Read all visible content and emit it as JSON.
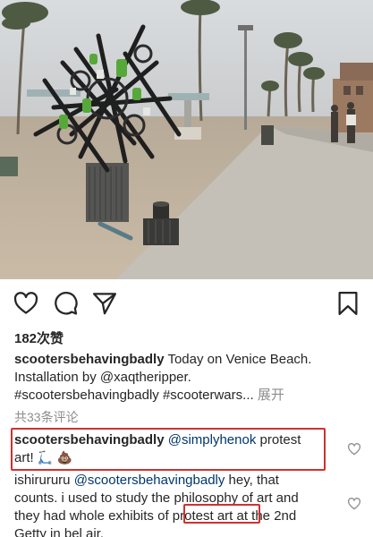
{
  "post": {
    "likes_text": "182次赞",
    "caption": {
      "username": "scootersbehavingbadly",
      "text_lines": [
        "Today on Venice Beach.",
        "Installation by @xaqtheripper.",
        "#scootersbehavingbadly #scooterwars..."
      ],
      "more_label": "展开"
    },
    "view_all_comments": "共33条评论"
  },
  "comments": [
    {
      "username": "scootersbehavingbadly",
      "mention": "@simplyhenok",
      "text_line1": "protest",
      "text_line2": "art!",
      "emoji_scooter": "🛴",
      "emoji_poop": "💩"
    },
    {
      "username": "ishirururu",
      "mention": "@scootersbehavingbadly",
      "text_a": "hey, that",
      "text_b": "counts. i used to study the philosophy of art and",
      "text_c": "they had whole exhibits of",
      "highlight": "protest art",
      "text_d": "at the 2nd",
      "text_e": "Getty in bel air."
    }
  ],
  "icons": {
    "like": "heart-icon",
    "comment": "comment-icon",
    "share": "share-icon",
    "save": "bookmark-icon"
  },
  "colors": {
    "highlight_box": "#d0312d",
    "text": "#262626",
    "muted": "#8e8e8e",
    "mention": "#00376b"
  }
}
